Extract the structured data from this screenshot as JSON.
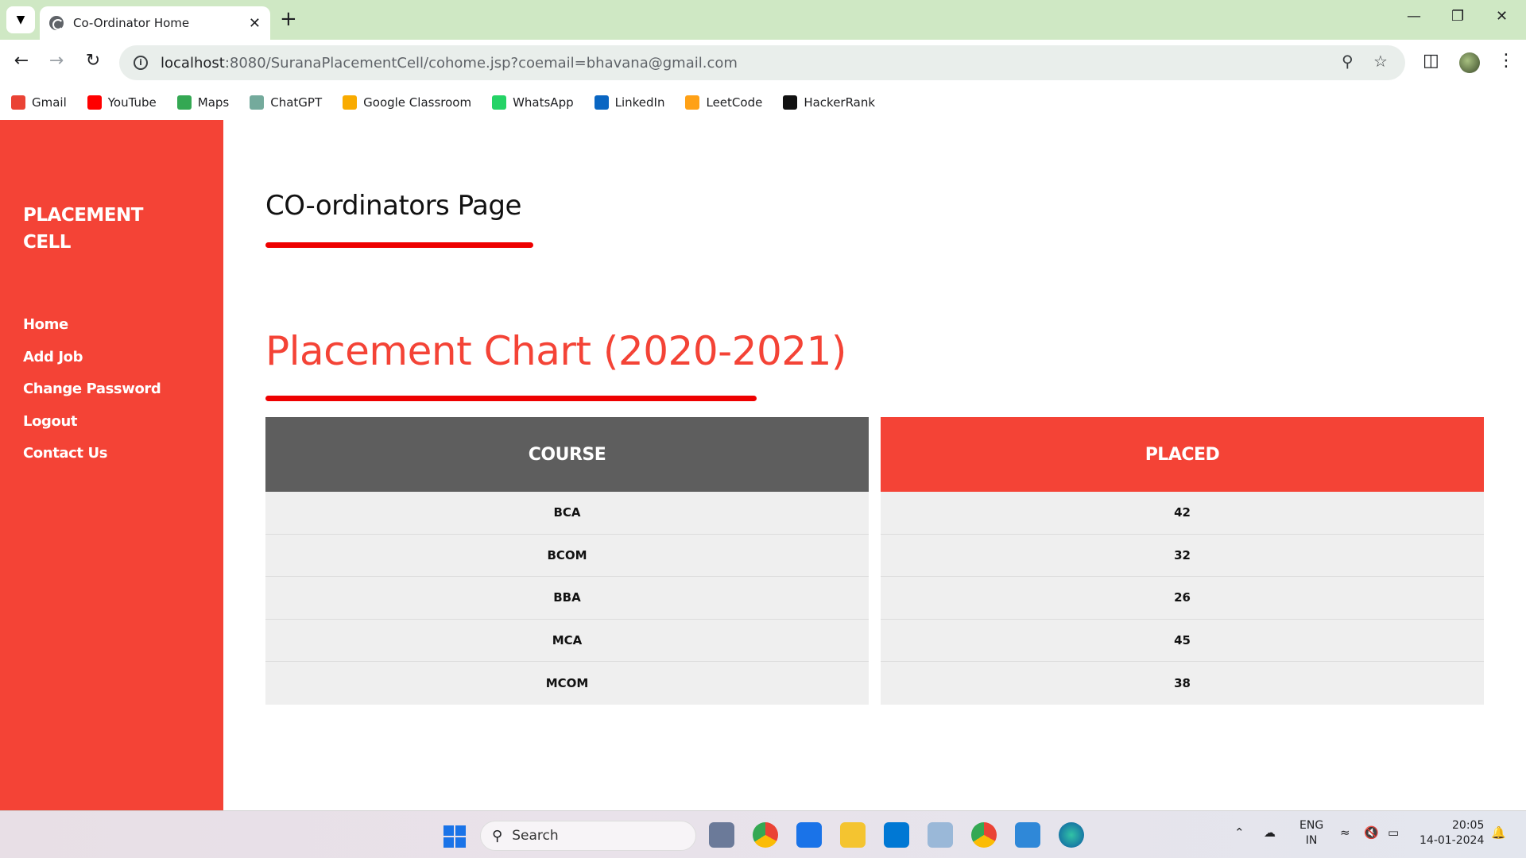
{
  "browser": {
    "tab_title": "Co-Ordinator Home",
    "url_host": "localhost",
    "url_rest": ":8080/SuranaPlacementCell/cohome.jsp?coemail=bhavana@gmail.com",
    "bookmarks": [
      {
        "label": "Gmail",
        "color": "#ea4335"
      },
      {
        "label": "YouTube",
        "color": "#ff0000"
      },
      {
        "label": "Maps",
        "color": "#34a853"
      },
      {
        "label": "ChatGPT",
        "color": "#74aa9c"
      },
      {
        "label": "Google Classroom",
        "color": "#f9ab00"
      },
      {
        "label": "WhatsApp",
        "color": "#25d366"
      },
      {
        "label": "LinkedIn",
        "color": "#0a66c2"
      },
      {
        "label": "LeetCode",
        "color": "#ffa116"
      },
      {
        "label": "HackerRank",
        "color": "#111111"
      }
    ]
  },
  "sidebar": {
    "brand": "PLACEMENT CELL",
    "items": [
      "Home",
      "Add Job",
      "Change Password",
      "Logout",
      "Contact Us"
    ]
  },
  "main": {
    "page_title": "CO-ordinators Page",
    "chart_title": "Placement Chart (2020-2021)"
  },
  "chart_data": {
    "type": "table",
    "columns": [
      "COURSE",
      "PLACED"
    ],
    "rows": [
      [
        "BCA",
        "42"
      ],
      [
        "BCOM",
        "32"
      ],
      [
        "BBA",
        "26"
      ],
      [
        "MCA",
        "45"
      ],
      [
        "MCOM",
        "38"
      ]
    ]
  },
  "taskbar": {
    "search_label": "Search",
    "lang_line1": "ENG",
    "lang_line2": "IN",
    "time": "20:05",
    "date": "14-01-2024"
  },
  "colors": {
    "accent": "#f44336",
    "underline": "#ee0000",
    "course_header": "#5e5e5e"
  }
}
